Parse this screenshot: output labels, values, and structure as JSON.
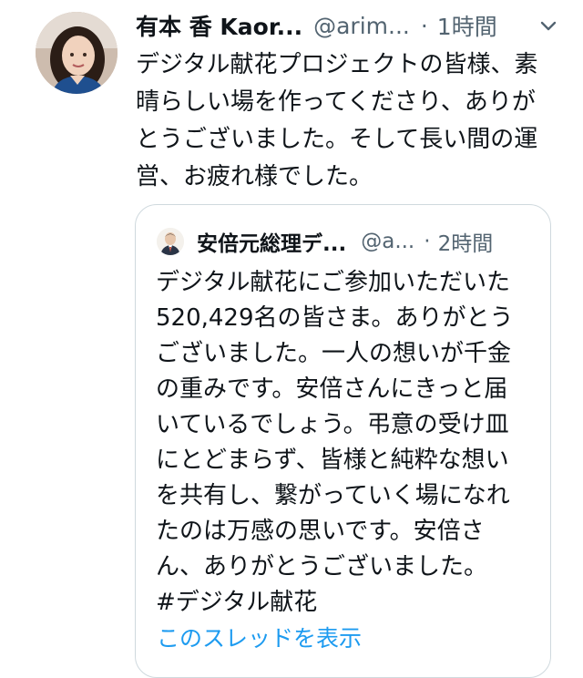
{
  "tweet": {
    "author": {
      "display_name": "有本 香 Kaor...",
      "handle": "@arim...",
      "avatar_icon": "profile-photo"
    },
    "separator": "·",
    "time": "1時間",
    "text": "デジタル献花プロジェクトの皆様、素晴らしい場を作ってくださり、ありがとうございました。そして長い間の運営、お疲れ様でした。",
    "more_icon": "chevron-down-icon"
  },
  "quoted_tweet": {
    "author": {
      "display_name": "安倍元総理デ...",
      "handle": "@a...",
      "avatar_icon": "profile-photo"
    },
    "separator": "·",
    "time": "2時間",
    "text": "デジタル献花にご参加いただいた520,429名の皆さま。ありがとうございました。一人の想いが千金の重みです。安倍さんにきっと届いているでしょう。弔意の受け皿にとどまらず、皆様と純粋な想いを共有し、繋がっていく場になれたのは万感の思いです。安倍さん、ありがとうございました。\n#デジタル献花"
  },
  "show_thread_label": "このスレッドを表示",
  "colors": {
    "text": "#0f1419",
    "secondary": "#536471",
    "link": "#1d9bf0",
    "border": "#cfd9de"
  }
}
